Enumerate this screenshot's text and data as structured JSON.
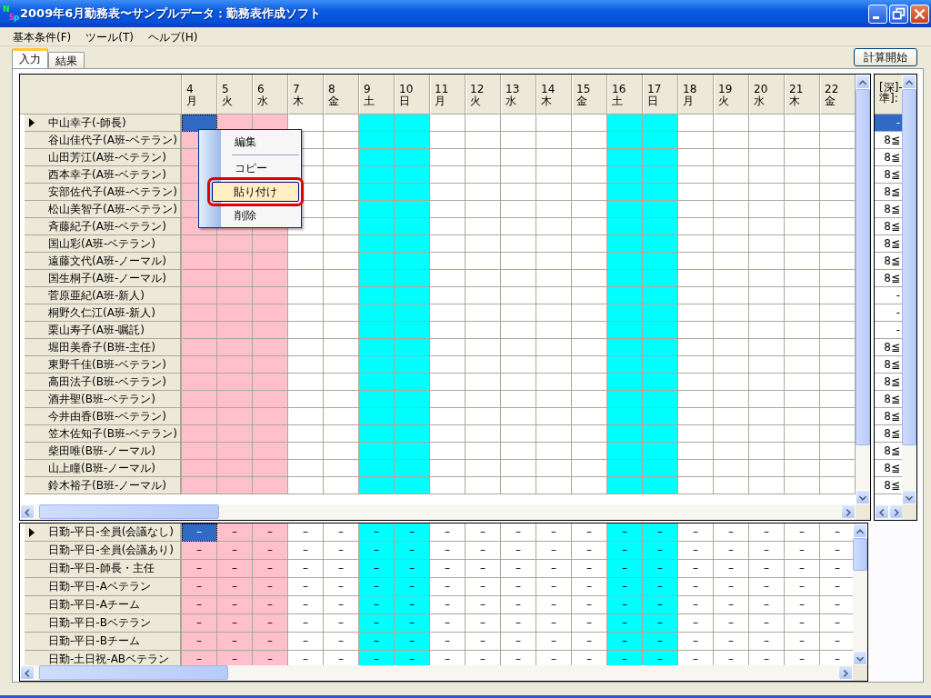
{
  "window": {
    "icon_text": "NSp",
    "title": "2009年6月勤務表〜サンプルデータ：勤務表作成ソフト"
  },
  "menu": [
    "基本条件(F)",
    "ツール(T)",
    "ヘルプ(H)"
  ],
  "tabs": [
    {
      "label": "入力",
      "selected": true
    },
    {
      "label": "結果",
      "selected": false
    }
  ],
  "start_button": "計算開始",
  "columns": [
    {
      "day": "4",
      "weekday": "月",
      "color": "#ffc0cb"
    },
    {
      "day": "5",
      "weekday": "火",
      "color": "#ffc0cb"
    },
    {
      "day": "6",
      "weekday": "水",
      "color": "#ffc0cb"
    },
    {
      "day": "7",
      "weekday": "木",
      "color": "#ffffff"
    },
    {
      "day": "8",
      "weekday": "金",
      "color": "#ffffff"
    },
    {
      "day": "9",
      "weekday": "土",
      "color": "#00ffff"
    },
    {
      "day": "10",
      "weekday": "日",
      "color": "#00ffff"
    },
    {
      "day": "11",
      "weekday": "月",
      "color": "#ffffff"
    },
    {
      "day": "12",
      "weekday": "火",
      "color": "#ffffff"
    },
    {
      "day": "13",
      "weekday": "水",
      "color": "#ffffff"
    },
    {
      "day": "14",
      "weekday": "木",
      "color": "#ffffff"
    },
    {
      "day": "15",
      "weekday": "金",
      "color": "#ffffff"
    },
    {
      "day": "16",
      "weekday": "土",
      "color": "#00ffff"
    },
    {
      "day": "17",
      "weekday": "日",
      "color": "#00ffff"
    },
    {
      "day": "18",
      "weekday": "月",
      "color": "#ffffff"
    },
    {
      "day": "19",
      "weekday": "火",
      "color": "#ffffff"
    },
    {
      "day": "20",
      "weekday": "水",
      "color": "#ffffff"
    },
    {
      "day": "21",
      "weekday": "木",
      "color": "#ffffff"
    },
    {
      "day": "22",
      "weekday": "金",
      "color": "#ffffff"
    }
  ],
  "staff_rows": [
    {
      "name": "中山幸子(-師長)",
      "selected": true
    },
    {
      "name": "谷山佳代子(A班-ベテラン)",
      "selected": false
    },
    {
      "name": "山田芳江(A班-ベテラン)",
      "selected": false
    },
    {
      "name": "西本幸子(A班-ベテラン)",
      "selected": false
    },
    {
      "name": "安部佐代子(A班-ベテラン)",
      "selected": false
    },
    {
      "name": "松山美智子(A班-ベテラン)",
      "selected": false
    },
    {
      "name": "斉藤紀子(A班-ベテラン)",
      "selected": false
    },
    {
      "name": "国山彩(A班-ベテラン)",
      "selected": false
    },
    {
      "name": "遠藤文代(A班-ノーマル)",
      "selected": false
    },
    {
      "name": "国生桐子(A班-ノーマル)",
      "selected": false
    },
    {
      "name": "菅原亜紀(A班-新人)",
      "selected": false
    },
    {
      "name": "桐野久仁江(A班-新人)",
      "selected": false
    },
    {
      "name": "栗山寿子(A班-嘱託)",
      "selected": false
    },
    {
      "name": "堀田美香子(B班-主任)",
      "selected": false
    },
    {
      "name": "東野千佳(B班-ベテラン)",
      "selected": false
    },
    {
      "name": "高田法子(B班-ベテラン)",
      "selected": false
    },
    {
      "name": "酒井聖(B班-ベテラン)",
      "selected": false
    },
    {
      "name": "今井由香(B班-ベテラン)",
      "selected": false
    },
    {
      "name": "笠木佐知子(B班-ベテラン)",
      "selected": false
    },
    {
      "name": "柴田唯(B班-ノーマル)",
      "selected": false
    },
    {
      "name": "山上瞳(B班-ノーマル)",
      "selected": false
    },
    {
      "name": "鈴木裕子(B班-ノーマル)",
      "selected": false
    }
  ],
  "side_panel": {
    "header": [
      "[深]-",
      "準]:"
    ],
    "values": [
      {
        "text": "-",
        "selected": true
      },
      {
        "text": "8≦",
        "selected": false
      },
      {
        "text": "8≦",
        "selected": false
      },
      {
        "text": "8≦",
        "selected": false
      },
      {
        "text": "8≦",
        "selected": false
      },
      {
        "text": "8≦",
        "selected": false
      },
      {
        "text": "8≦",
        "selected": false
      },
      {
        "text": "8≦",
        "selected": false
      },
      {
        "text": "8≦",
        "selected": false
      },
      {
        "text": "8≦",
        "selected": false
      },
      {
        "text": "-",
        "selected": false
      },
      {
        "text": "-",
        "selected": false
      },
      {
        "text": "-",
        "selected": false
      },
      {
        "text": "8≦",
        "selected": false
      },
      {
        "text": "8≦",
        "selected": false
      },
      {
        "text": "8≦",
        "selected": false
      },
      {
        "text": "8≦",
        "selected": false
      },
      {
        "text": "8≦",
        "selected": false
      },
      {
        "text": "8≦",
        "selected": false
      },
      {
        "text": "8≦",
        "selected": false
      },
      {
        "text": "8≦",
        "selected": false
      },
      {
        "text": "8≦",
        "selected": false
      }
    ]
  },
  "context_menu": [
    {
      "label": "編集",
      "selected": false,
      "separator_after": true
    },
    {
      "label": "コピー",
      "selected": false,
      "separator_after": false
    },
    {
      "label": "貼り付け",
      "selected": true,
      "separator_after": false
    },
    {
      "label": "削除",
      "selected": false,
      "separator_after": false
    }
  ],
  "shift_rows": [
    {
      "name": "日勤-平日-全員(会議なし)",
      "selected": true,
      "cells": [
        "–",
        "–",
        "–",
        "–",
        "–",
        "–",
        "–",
        "–",
        "–",
        "–",
        "–",
        "–",
        "–",
        "–",
        "–",
        "–",
        "–",
        "–",
        "–"
      ]
    },
    {
      "name": "日勤-平日-全員(会議あり)",
      "selected": false,
      "cells": [
        "–",
        "–",
        "–",
        "–",
        "–",
        "–",
        "–",
        "–",
        "–",
        "–",
        "–",
        "–",
        "–",
        "–",
        "–",
        "–",
        "–",
        "–",
        "–"
      ]
    },
    {
      "name": "日勤-平日-師長・主任",
      "selected": false,
      "cells": [
        "–",
        "–",
        "–",
        "–",
        "–",
        "–",
        "–",
        "–",
        "–",
        "–",
        "–",
        "–",
        "–",
        "–",
        "–",
        "–",
        "–",
        "–",
        "–"
      ]
    },
    {
      "name": "日勤-平日-Aベテラン",
      "selected": false,
      "cells": [
        "–",
        "–",
        "–",
        "–",
        "–",
        "–",
        "–",
        "–",
        "–",
        "–",
        "–",
        "–",
        "–",
        "–",
        "–",
        "–",
        "–",
        "–",
        "–"
      ]
    },
    {
      "name": "日勤-平日-Aチーム",
      "selected": false,
      "cells": [
        "–",
        "–",
        "–",
        "–",
        "–",
        "–",
        "–",
        "–",
        "–",
        "–",
        "–",
        "–",
        "–",
        "–",
        "–",
        "–",
        "–",
        "–",
        "–"
      ]
    },
    {
      "name": "日勤-平日-Bベテラン",
      "selected": false,
      "cells": [
        "–",
        "–",
        "–",
        "–",
        "–",
        "–",
        "–",
        "–",
        "–",
        "–",
        "–",
        "–",
        "–",
        "–",
        "–",
        "–",
        "–",
        "–",
        "–"
      ]
    },
    {
      "name": "日勤-平日-Bチーム",
      "selected": false,
      "cells": [
        "–",
        "–",
        "–",
        "–",
        "–",
        "–",
        "–",
        "–",
        "–",
        "–",
        "–",
        "–",
        "–",
        "–",
        "–",
        "–",
        "–",
        "–",
        "–"
      ]
    },
    {
      "name": "日勤-土日祝-ABベテラン",
      "selected": false,
      "cells": [
        "–",
        "–",
        "–",
        "–",
        "–",
        "–",
        "–",
        "–",
        "–",
        "–",
        "–",
        "–",
        "–",
        "–",
        "–",
        "–",
        "–",
        "–",
        "–"
      ]
    }
  ]
}
